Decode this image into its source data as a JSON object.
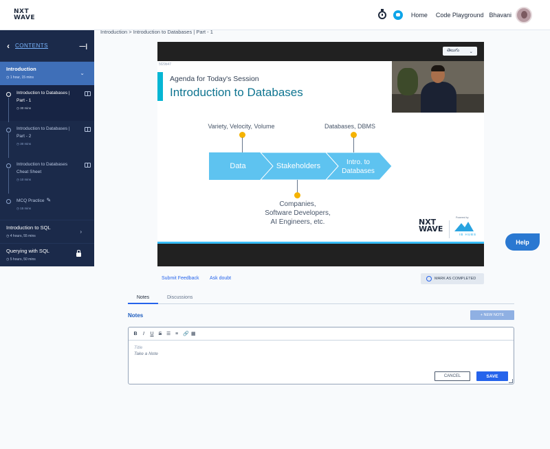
{
  "header": {
    "logo_line1": "NXT",
    "logo_line2": "WAVE",
    "nav": [
      "Home",
      "Code Playground"
    ],
    "username": "Bhavani",
    "icons": [
      "stopwatch-icon",
      "chat-icon",
      "avatar"
    ]
  },
  "sidebar": {
    "contents_label": "CONTENTS",
    "active_unit": {
      "title": "Introduction",
      "meta": "1 hour, 15 mins"
    },
    "topics": [
      {
        "title": "Introduction to Databases | Part - 1",
        "meta": "30 mins",
        "active": true,
        "icon": "book-icon"
      },
      {
        "title": "Introduction to Databases | Part - 2",
        "meta": "30 mins",
        "active": false,
        "icon": "book-icon"
      },
      {
        "title": "Introduction to Databases Cheat Sheet",
        "meta": "10 mins",
        "active": false,
        "icon": "book-icon"
      },
      {
        "title": "MCQ Practice",
        "meta": "15 mins",
        "active": false,
        "icon": "pencil-icon"
      }
    ],
    "units": [
      {
        "title": "Introduction to SQL",
        "meta": "4 hours, 55 mins",
        "icon": "chevron-right-icon"
      },
      {
        "title": "Querying with SQL",
        "meta": "5 hours, 50 mins",
        "icon": "lock-icon"
      }
    ]
  },
  "breadcrumb": "Introduction > Introduction to Databases | Part - 1",
  "video": {
    "language": "తెలుగు",
    "slide_id": "5f29b47",
    "agenda": "Agenda for Today's Session",
    "title": "Introduction to Databases",
    "top_label_left": "Variety, Velocity, Volume",
    "top_label_right": "Databases, DBMS",
    "flow": [
      "Data",
      "Stakeholders",
      "Intro. to Databases"
    ],
    "bottom_label": [
      "Companies,",
      "Software Developers,",
      "AI Engineers, etc."
    ],
    "brand_line1": "NXT",
    "brand_line2": "WAVE",
    "powered_by": "Powered by",
    "ib_hubs": "IB HUBS",
    "colors": {
      "arrow": "#5ec3f0",
      "accent": "#0e7490",
      "pin": "#f5b301"
    }
  },
  "help_label": "Help",
  "actions": {
    "submit_feedback": "Submit Feedback",
    "ask_doubt": "Ask doubt",
    "mark_completed": "MARK AS COMPLETED"
  },
  "tabs": [
    "Notes",
    "Discussions"
  ],
  "notes": {
    "heading": "Notes",
    "new_note": "+ NEW NOTE",
    "toolbar": [
      "B",
      "I",
      "U",
      "S",
      "1.",
      "•",
      "link",
      "img"
    ],
    "title_placeholder": "Title",
    "body_placeholder": "Take a Note",
    "cancel": "CANCEL",
    "save": "SAVE"
  }
}
